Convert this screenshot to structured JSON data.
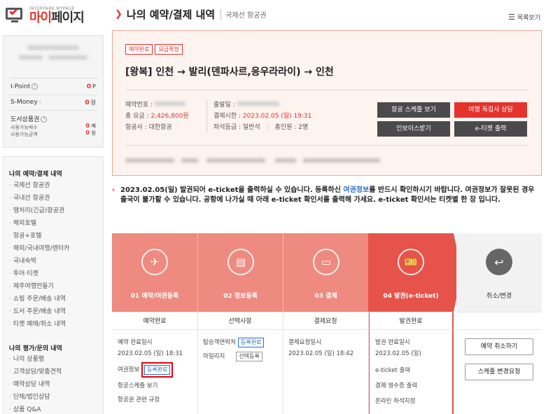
{
  "sidebar": {
    "logo_small": "INTERPARK MYPAGE",
    "logo_red": "마이",
    "logo_dark": "페이지",
    "points": [
      {
        "label": "I-Point",
        "value": "0",
        "unit": "P"
      },
      {
        "label": "S-Money",
        "value": "0",
        "unit": "원"
      }
    ],
    "gift_label": "도서상품권",
    "gift_sub1": "사용가능매수",
    "gift_sub2": "사용가능금액",
    "gift_val1": "0",
    "gift_unit1": "매",
    "gift_val2": "0",
    "gift_unit2": "원",
    "menu1_title": "나의 예약/결제 내역",
    "menu1_items": [
      "국제선 항공권",
      "국내선 항공권",
      "땡처리(긴급)항공권",
      "해외호텔",
      "항공+호텔",
      "해외/국내여행/렌터카",
      "국내숙박",
      "투어·티켓",
      "제주여행만들기",
      "쇼핑 주문/배송 내역",
      "도서 주문/배송 내역",
      "티켓 예매/취소 내역"
    ],
    "menu2_title": "나의 평가/문의 내역",
    "menu2_items": [
      "나의 상품평",
      "고객상담/맞춤견적",
      "예약상담 내역",
      "단체/법인상담",
      "상품 Q&A"
    ]
  },
  "header": {
    "title": "나의 예약/결제 내역",
    "subtitle": "국제선 항공권",
    "list_view": "목록보기"
  },
  "summary": {
    "badges": [
      "예약완료",
      "요금확정"
    ],
    "route": "[왕복] 인천 → 발리(덴파사르,응우라라이) → 인천",
    "reservation_no_label": "예약번호 :",
    "total_label": "총 요금 :",
    "total_value": "2,426,800원",
    "airline_label": "항공사 :",
    "airline_value": "대한항공",
    "departure_label": "출발일 :",
    "deadline_label": "결제시한 :",
    "deadline_value": "2023.02.05 (일) 19:31",
    "seat_label": "좌석등급 :",
    "seat_value": "일반석",
    "people_label": "총인원 :",
    "people_value": "2명",
    "buttons": {
      "schedule": "항공 스케줄 보기",
      "consult": "여행 독집사 상담",
      "invoice": "인보이스받기",
      "eticket": "e-티켓 출력"
    }
  },
  "notice": {
    "part1": "2023.02.05(일) 발권되어 e-ticket을 출력하실 수 있습니다. 등록하신 ",
    "link": "여권정보",
    "part2": "를 반드시 확인하시기 바랍니다. 여권정보가 잘못된 경우 출국이 불가할 수 있습니다. 공항에 나가실 때 아래 e-ticket 확인서를 출력해 가세요. e-ticket 확인서는 티켓별 한 장 입니다."
  },
  "steps": [
    {
      "label": "01 예약/여권등록",
      "status": "예약완료",
      "icon": "airplane-icon"
    },
    {
      "label": "02 정보등록",
      "status": "선택사항",
      "icon": "form-icon"
    },
    {
      "label": "03 결제",
      "status": "결제요청",
      "icon": "card-icon"
    },
    {
      "label": "04 발권(e-ticket)",
      "status": "발권완료",
      "icon": "ticket-icon"
    }
  ],
  "step1": {
    "done_label": "예약 완료일시",
    "done_value": "2023.02.05 (일) 18:31",
    "passport_label": "여권정보",
    "passport_tag": "등록완료",
    "schedule_link": "항공스케줄 보기",
    "rules_link": "항공권 관련 규정"
  },
  "step2": {
    "contact_label": "탑승객연락처",
    "contact_tag": "등록완료",
    "mileage_label": "마일리지",
    "mileage_tag": "선택등록"
  },
  "step3": {
    "request_label": "결제요청일시",
    "request_value": "2023.02.05 (일) 18:42"
  },
  "step4": {
    "issue_label": "발권 완료일시",
    "issue_value": "2023.02.05 (일)",
    "eticket_print": "e-ticket 출력",
    "receipt_print": "결제 영수증 출력",
    "online_seat": "온라인 좌석지정"
  },
  "cancel": {
    "label": "취소/변경",
    "cancel_btn": "예약 취소하기",
    "change_btn": "스케줄 변경요청"
  }
}
